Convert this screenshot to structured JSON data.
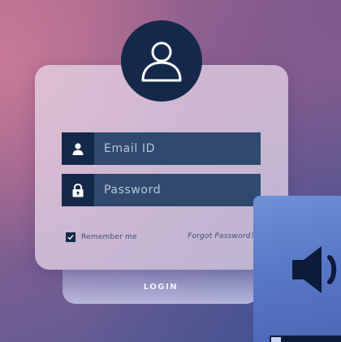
{
  "login_form": {
    "email_placeholder": "Email ID",
    "password_placeholder": "Password",
    "remember_label": "Remember me",
    "remember_checked": true,
    "forgot_label": "Forgot Password?",
    "login_label": "LOGIN"
  },
  "icons": {
    "avatar": "user-outline-icon",
    "email": "user-icon",
    "password": "lock-icon",
    "volume": "speaker-volume-icon"
  },
  "colors": {
    "navy": "#14294a",
    "field": "#2f4a6e",
    "card": "#e9daec",
    "tile": "#5877c6"
  }
}
